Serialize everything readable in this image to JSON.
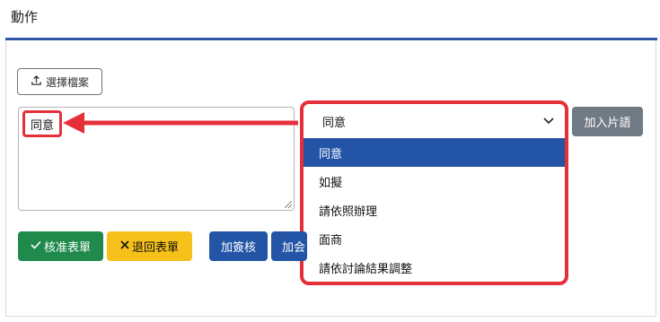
{
  "panel": {
    "title": "動作"
  },
  "upload": {
    "label": "選擇檔案",
    "icon": "upload-icon"
  },
  "textarea": {
    "value": "同意"
  },
  "phrase_select": {
    "selected": "同意",
    "options": [
      "同意",
      "如擬",
      "請依照辦理",
      "面商",
      "請依討論結果調整"
    ]
  },
  "buttons": {
    "add_phrase": "加入片語",
    "approve": "核准表單",
    "return": "退回表單",
    "add_sign": "加簽核",
    "add_partial": "加会"
  },
  "colors": {
    "accent": "#2354a6",
    "highlight": "#e5303a",
    "approve": "#1f8a4c",
    "return": "#f5c11a",
    "secondary": "#707a84"
  }
}
